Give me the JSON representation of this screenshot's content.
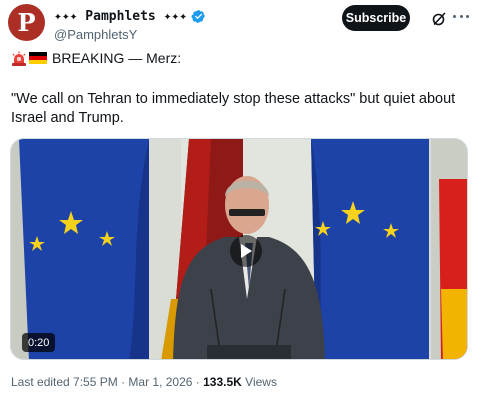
{
  "header": {
    "display_name": "✦✦✦ Pamphlets ✦✦✦",
    "handle": "@PamphletsY",
    "avatar_letter": "P",
    "subscribe_label": "Subscribe"
  },
  "post": {
    "line1_text": "BREAKING — Merz:",
    "quote": "\"We call on Tehran to immediately stop these attacks\" but quiet about Israel and Trump.",
    "icons": [
      "siren-icon",
      "germany-flag-icon"
    ]
  },
  "media": {
    "duration": "0:20"
  },
  "footer": {
    "edited": "Last edited 7:55 PM · Mar 1, 2026 · ",
    "views_count": "133.5K",
    "views_label": "Views"
  },
  "colors": {
    "avatar_bg": "#ab2f25",
    "verified": "#1d9bf0",
    "eu_flag": "#1d43a8",
    "eu_stars": "#f7d21d",
    "de_red": "#d7201c",
    "de_gold": "#f2b400"
  }
}
